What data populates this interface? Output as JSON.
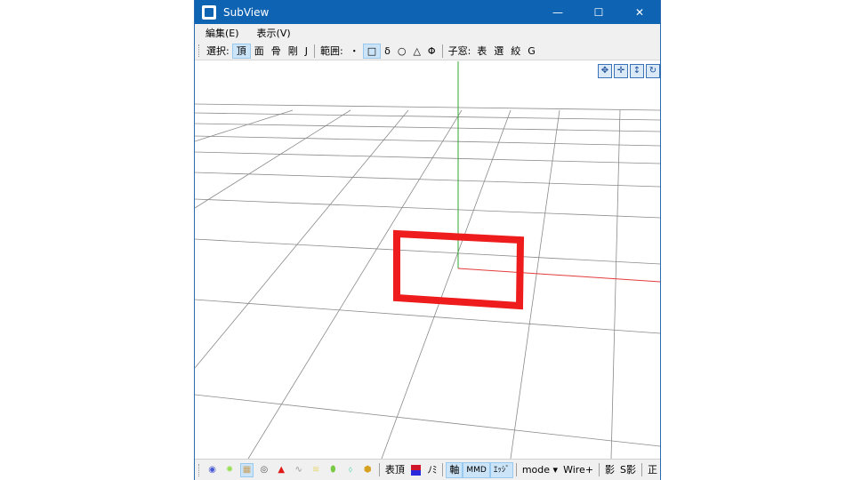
{
  "window": {
    "title": "SubView",
    "controls": {
      "minimize": "—",
      "maximize": "☐",
      "close": "✕"
    }
  },
  "menubar": {
    "items": [
      "編集(E)",
      "表示(V)"
    ]
  },
  "toolbar": {
    "select_label": "選択:",
    "select_items": [
      "頂",
      "面",
      "骨",
      "剛",
      "J"
    ],
    "range_label": "範囲:",
    "range_items": [
      "・",
      "□",
      "δ",
      "○",
      "△",
      "Φ"
    ],
    "child_label": "子窓:",
    "child_items": [
      "表",
      "選",
      "絞",
      "G"
    ]
  },
  "navigation": {
    "icons": [
      "move-icon",
      "pan-icon",
      "zoom-icon",
      "rotate-icon"
    ]
  },
  "statusbar": {
    "texts": {
      "vertex_display": "表頂",
      "mi": "ﾉﾐ",
      "axis": "軸",
      "mmd": "MMD",
      "edge": "ｴｯｼﾞ",
      "mode": "mode",
      "mode_arrow": "▾",
      "wire_plus": "Wire+",
      "shadow": "影",
      "s_shadow": "S影",
      "front": "正"
    }
  },
  "colors": {
    "titlebar": "#0e63b3",
    "grid": "#8a8a8a",
    "axis_x": "#e23c3c",
    "axis_y": "#2fa52f",
    "highlight": "#ee1c1c"
  }
}
